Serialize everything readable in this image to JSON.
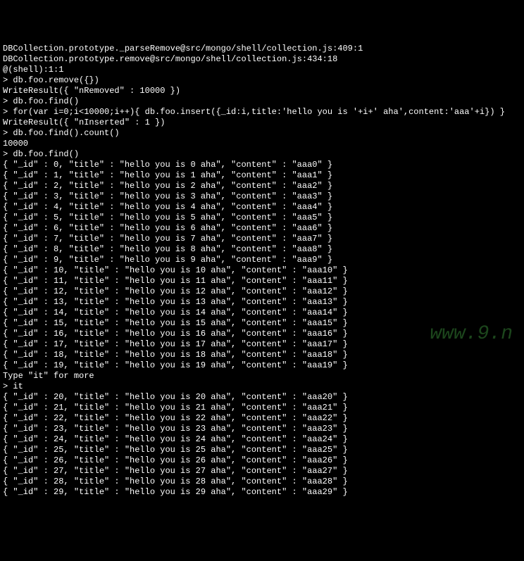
{
  "header": [
    "DBCollection.prototype._parseRemove@src/mongo/shell/collection.js:409:1",
    "DBCollection.prototype.remove@src/mongo/shell/collection.js:434:18",
    "@(shell):1:1",
    "> db.foo.remove({})",
    "WriteResult({ \"nRemoved\" : 10000 })",
    "> db.foo.find()",
    "> for(var i=0;i<10000;i++){ db.foo.insert({_id:i,title:'hello you is '+i+' aha',content:'aaa'+i}) }",
    "WriteResult({ \"nInserted\" : 1 })",
    "> db.foo.find().count()",
    "10000",
    "> db.foo.find()"
  ],
  "batch1": [
    {
      "_id": 0,
      "title": "hello you is 0 aha",
      "content": "aaa0"
    },
    {
      "_id": 1,
      "title": "hello you is 1 aha",
      "content": "aaa1"
    },
    {
      "_id": 2,
      "title": "hello you is 2 aha",
      "content": "aaa2"
    },
    {
      "_id": 3,
      "title": "hello you is 3 aha",
      "content": "aaa3"
    },
    {
      "_id": 4,
      "title": "hello you is 4 aha",
      "content": "aaa4"
    },
    {
      "_id": 5,
      "title": "hello you is 5 aha",
      "content": "aaa5"
    },
    {
      "_id": 6,
      "title": "hello you is 6 aha",
      "content": "aaa6"
    },
    {
      "_id": 7,
      "title": "hello you is 7 aha",
      "content": "aaa7"
    },
    {
      "_id": 8,
      "title": "hello you is 8 aha",
      "content": "aaa8"
    },
    {
      "_id": 9,
      "title": "hello you is 9 aha",
      "content": "aaa9"
    },
    {
      "_id": 10,
      "title": "hello you is 10 aha",
      "content": "aaa10"
    },
    {
      "_id": 11,
      "title": "hello you is 11 aha",
      "content": "aaa11"
    },
    {
      "_id": 12,
      "title": "hello you is 12 aha",
      "content": "aaa12"
    },
    {
      "_id": 13,
      "title": "hello you is 13 aha",
      "content": "aaa13"
    },
    {
      "_id": 14,
      "title": "hello you is 14 aha",
      "content": "aaa14"
    },
    {
      "_id": 15,
      "title": "hello you is 15 aha",
      "content": "aaa15"
    },
    {
      "_id": 16,
      "title": "hello you is 16 aha",
      "content": "aaa16"
    },
    {
      "_id": 17,
      "title": "hello you is 17 aha",
      "content": "aaa17"
    },
    {
      "_id": 18,
      "title": "hello you is 18 aha",
      "content": "aaa18"
    },
    {
      "_id": 19,
      "title": "hello you is 19 aha",
      "content": "aaa19"
    }
  ],
  "more_hint": "Type \"it\" for more",
  "it_cmd": "> it",
  "batch2": [
    {
      "_id": 20,
      "title": "hello you is 20 aha",
      "content": "aaa20"
    },
    {
      "_id": 21,
      "title": "hello you is 21 aha",
      "content": "aaa21"
    },
    {
      "_id": 22,
      "title": "hello you is 22 aha",
      "content": "aaa22"
    },
    {
      "_id": 23,
      "title": "hello you is 23 aha",
      "content": "aaa23"
    },
    {
      "_id": 24,
      "title": "hello you is 24 aha",
      "content": "aaa24"
    },
    {
      "_id": 25,
      "title": "hello you is 25 aha",
      "content": "aaa25"
    },
    {
      "_id": 26,
      "title": "hello you is 26 aha",
      "content": "aaa26"
    },
    {
      "_id": 27,
      "title": "hello you is 27 aha",
      "content": "aaa27"
    },
    {
      "_id": 28,
      "title": "hello you is 28 aha",
      "content": "aaa28"
    },
    {
      "_id": 29,
      "title": "hello you is 29 aha",
      "content": "aaa29"
    }
  ],
  "watermark": "www.9.n"
}
